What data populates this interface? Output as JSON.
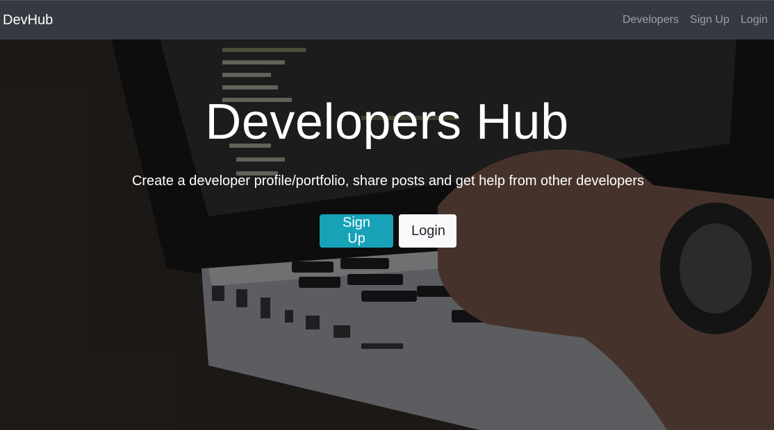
{
  "navbar": {
    "brand": "DevHub",
    "links": [
      "Developers",
      "Sign Up",
      "Login"
    ]
  },
  "hero": {
    "title": "Developers Hub",
    "subtitle": "Create a developer profile/portfolio, share posts and get help from other developers",
    "buttons": {
      "signup": "Sign Up",
      "login": "Login"
    }
  },
  "colors": {
    "navbar_bg": "#343a40",
    "signup_button_bg": "#17a2b8",
    "login_button_bg": "#f8f9fa"
  }
}
